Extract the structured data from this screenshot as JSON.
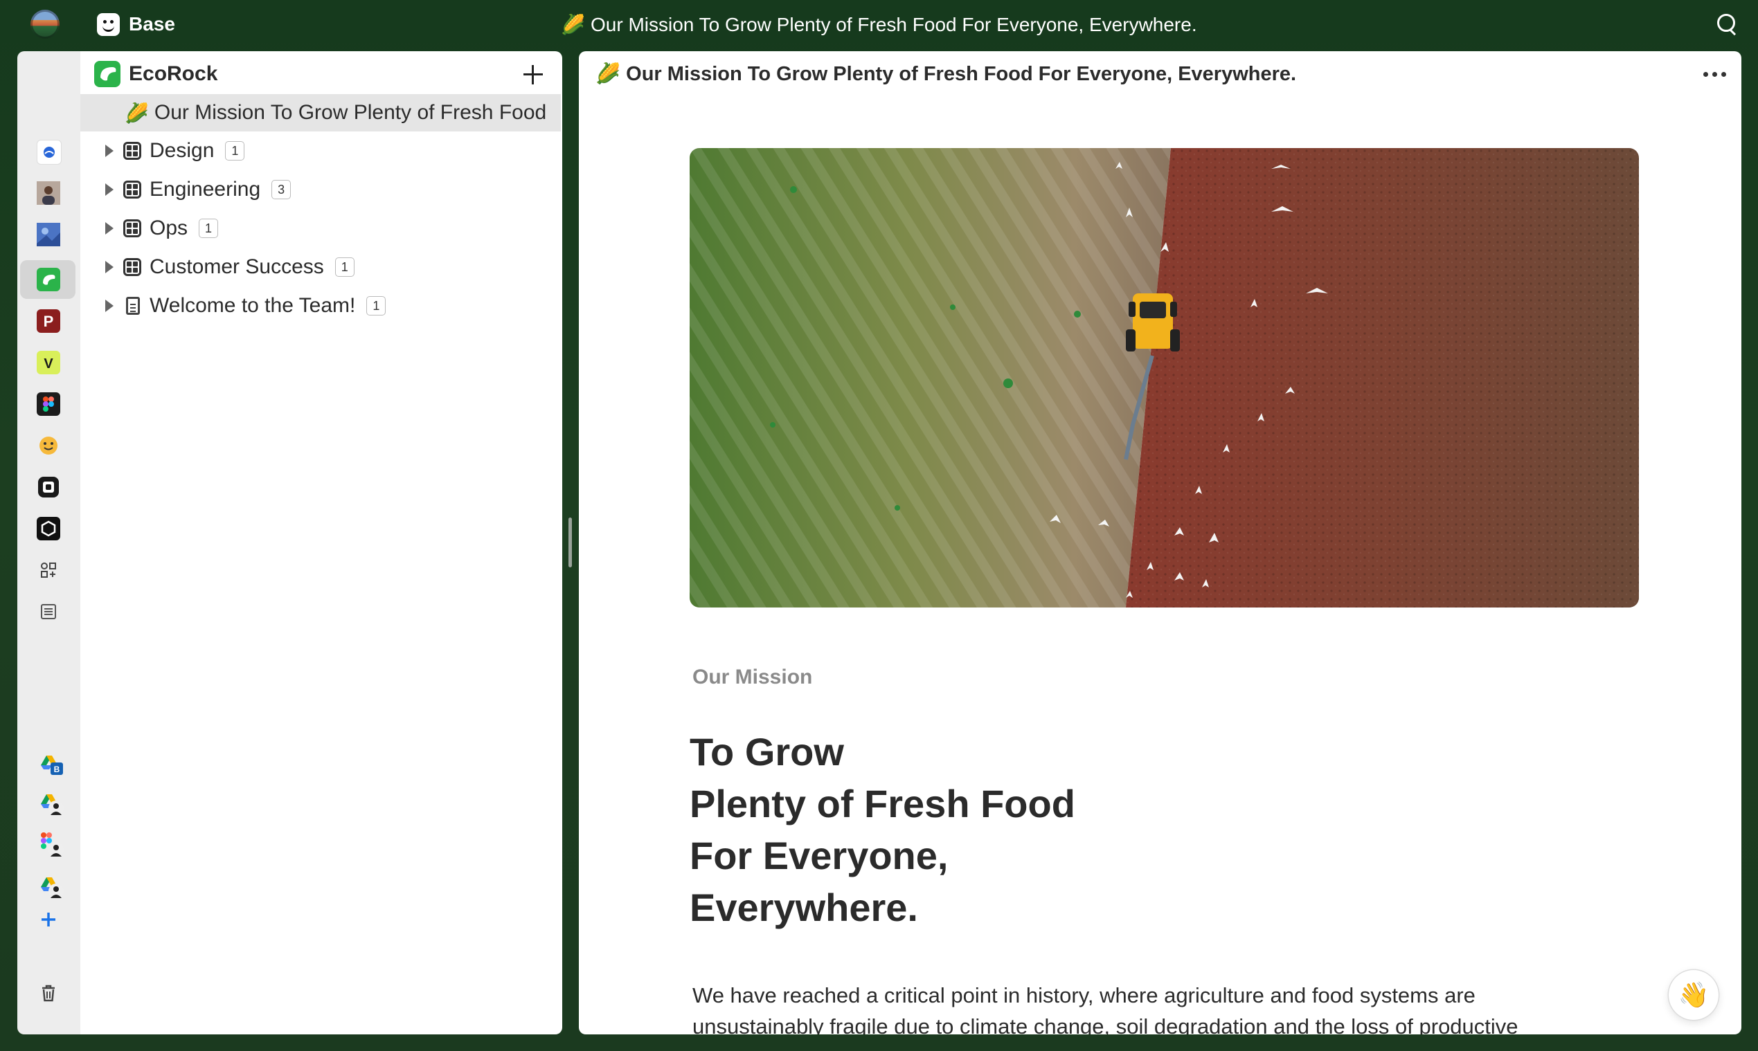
{
  "app": {
    "name": "Base"
  },
  "window": {
    "title": "🌽 Our Mission To Grow Plenty of Fresh Food For Everyone, Everywhere."
  },
  "rail": {
    "apps": [
      "confluence-icon",
      "avatar-icon",
      "photo-icon",
      "ecorock-icon",
      "p-icon",
      "v-icon",
      "figma-icon",
      "emoji-icon",
      "capture-icon",
      "hexagon-icon",
      "apps-icon",
      "list-icon"
    ],
    "connections": [
      "drive-b-icon",
      "drive-person-icon",
      "figma-person-icon",
      "drive-person-2-icon"
    ],
    "colors": {
      "ecorock": "#2bb34a",
      "p": "#8b1e1e",
      "v": "#d9ef5a"
    },
    "labels": {
      "p": "P",
      "v": "V",
      "b": "B"
    }
  },
  "sidebar": {
    "workspace": {
      "name": "EcoRock",
      "logo": "S"
    },
    "items": [
      {
        "label": "Our Mission To Grow Plenty of Fresh Food",
        "emoji": "🌽",
        "selected": true
      },
      {
        "label": "Design",
        "count": "1",
        "icon": "grid-icon"
      },
      {
        "label": "Engineering",
        "count": "3",
        "icon": "grid-icon"
      },
      {
        "label": "Ops",
        "count": "1",
        "icon": "grid-icon"
      },
      {
        "label": "Customer Success",
        "count": "1",
        "icon": "grid-icon"
      },
      {
        "label": "Welcome to the Team!",
        "count": "1",
        "icon": "doc-icon"
      }
    ]
  },
  "doc": {
    "title": "🌽 Our Mission To Grow Plenty of Fresh Food For Everyone, Everywhere.",
    "subtitle": "Our Mission",
    "headline": [
      "To Grow",
      "Plenty of Fresh Food",
      "For Everyone,",
      "Everywhere."
    ],
    "body": "We have reached a critical point in history, where agriculture and food systems are unsustainably fragile due to climate change, soil degradation and the loss of productive"
  },
  "wave": "👋"
}
